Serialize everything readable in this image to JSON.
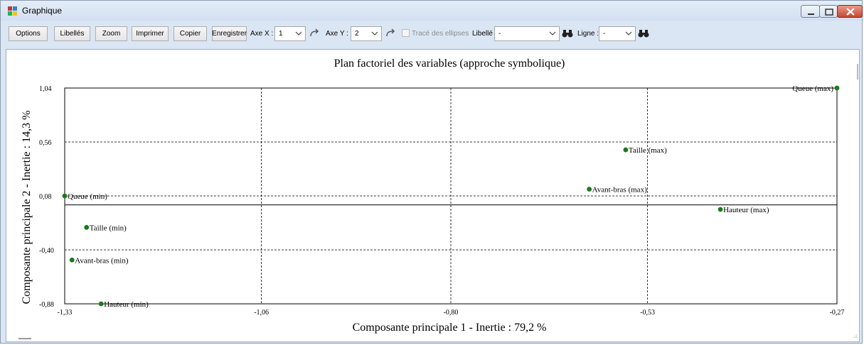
{
  "window": {
    "title": "Graphique"
  },
  "toolbar": {
    "buttons": [
      "Options",
      "Libellés",
      "Zoom",
      "Imprimer",
      "Copier",
      "Enregistrer"
    ],
    "axe_x_label": "Axe X :",
    "axe_x_value": "1",
    "axe_y_label": "Axe Y :",
    "axe_y_value": "2",
    "ellipses_label": "Tracé des ellipses",
    "libelle_label": "Libellé :",
    "libelle_value": "-",
    "ligne_label": "Ligne :",
    "ligne_value": "-"
  },
  "colors": {
    "point": "#1a7a1a",
    "grid": "#000000",
    "background": "#ffffff"
  },
  "chart_data": {
    "type": "scatter",
    "title": "Plan factoriel des variables (approche symbolique)",
    "xlabel": "Composante principale 1 - Inertie :  79,2 %",
    "ylabel": "Composante principale 2 - Inertie :  14,3 %",
    "xlim": [
      -1.33,
      -0.27
    ],
    "ylim": [
      -0.88,
      1.04
    ],
    "x_ticks": [
      -1.33,
      -1.06,
      -0.8,
      -0.53,
      -0.27
    ],
    "x_tick_labels": [
      "-1,33",
      "-1,06",
      "-0,80",
      "-0,53",
      "-0,27"
    ],
    "y_ticks": [
      1.04,
      0.56,
      0.08,
      -0.4,
      -0.88
    ],
    "y_tick_labels": [
      "1,04",
      "0,56",
      "0,08",
      "-0,40",
      "-0,88"
    ],
    "zero_lines": {
      "x": 0,
      "y": 0
    },
    "grid": true,
    "points": [
      {
        "label": "Queue (max)",
        "x": -0.27,
        "y": 1.04
      },
      {
        "label": "Taille (max)",
        "x": -0.56,
        "y": 0.49
      },
      {
        "label": "Avant-bras (max)",
        "x": -0.61,
        "y": 0.14
      },
      {
        "label": "Hauteur (max)",
        "x": -0.43,
        "y": -0.04
      },
      {
        "label": "Queue (min)",
        "x": -1.33,
        "y": 0.08
      },
      {
        "label": "Taille (min)",
        "x": -1.3,
        "y": -0.2
      },
      {
        "label": "Avant-bras (min)",
        "x": -1.32,
        "y": -0.49
      },
      {
        "label": "Hauteur (min)",
        "x": -1.28,
        "y": -0.88
      }
    ]
  }
}
